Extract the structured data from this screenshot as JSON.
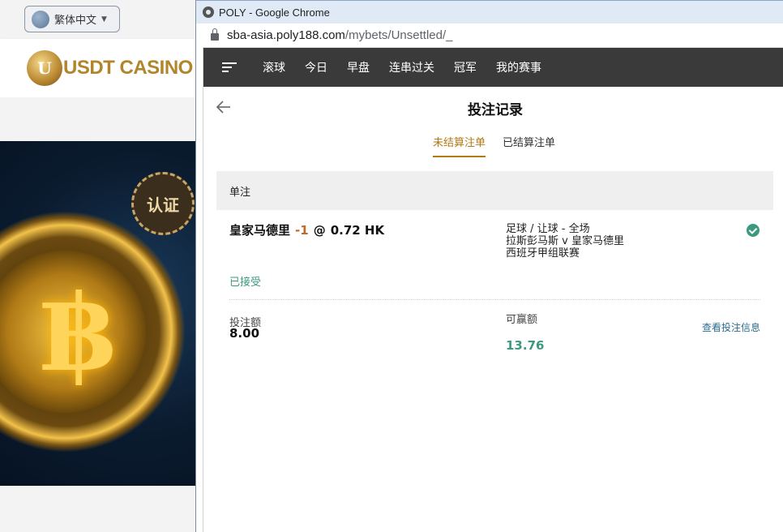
{
  "background_site": {
    "language_label": "繁体中文",
    "logo_letter": "U",
    "logo_text": "USDT CASINO",
    "seal_text": "认证",
    "banner_symbol": "฿"
  },
  "window": {
    "title": "POLY - Google Chrome",
    "url_host": "sba-asia.poly188.com",
    "url_path": "/mybets/Unsettled/_"
  },
  "nav": {
    "items": [
      "滚球",
      "今日",
      "早盘",
      "连串过关",
      "冠军",
      "我的赛事"
    ]
  },
  "page": {
    "title": "投注记录",
    "tabs": [
      {
        "label": "未结算注单",
        "active": true
      },
      {
        "label": "已结算注单",
        "active": false
      }
    ],
    "section_title": "单注"
  },
  "bet": {
    "team": "皇家马德里",
    "handicap": "-1",
    "at": "@",
    "odds": "0.72 HK",
    "market": "足球 / 让球 - 全场",
    "match": "拉斯彭马斯 v 皇家马德里",
    "league": "西班牙甲组联赛",
    "status": "已接受",
    "stake_label": "投注额",
    "stake_value": "8.00",
    "win_label": "可赢额",
    "win_value": "13.76",
    "view_link": "查看投注信息"
  },
  "colors": {
    "accent": "#b27a12",
    "success": "#3b9a7e",
    "handicap": "#c2662a",
    "navbar": "#3a3a3a"
  }
}
